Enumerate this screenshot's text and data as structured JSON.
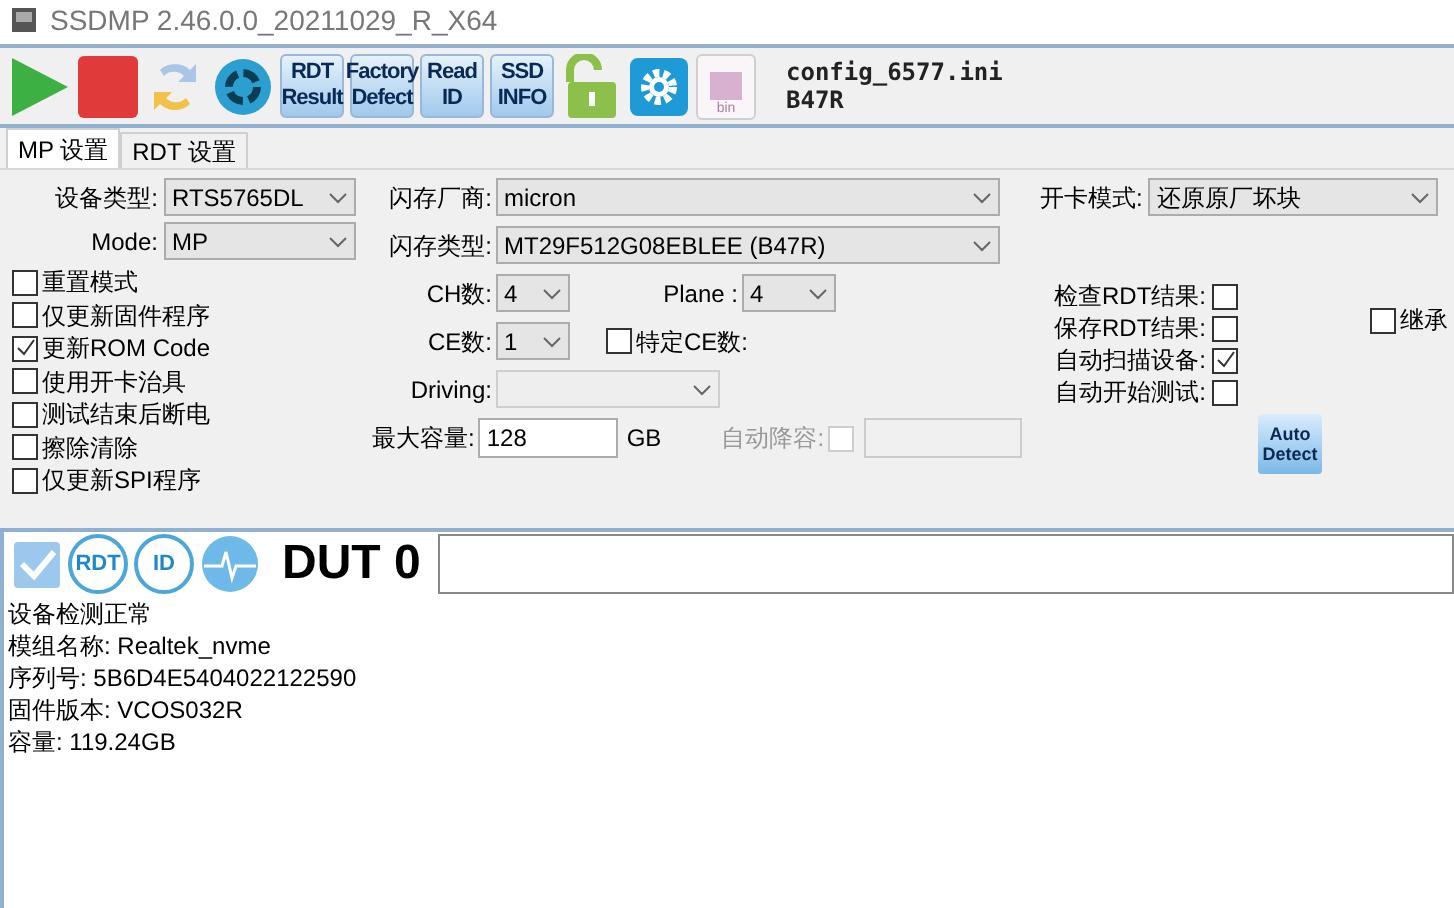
{
  "window": {
    "title": "SSDMP 2.46.0.0_20211029_R_X64"
  },
  "toolbar": {
    "buttons": [
      {
        "kind": "play"
      },
      {
        "kind": "stop"
      },
      {
        "kind": "refresh"
      },
      {
        "kind": "recycle"
      },
      {
        "kind": "text",
        "lines": [
          "RDT",
          "Result"
        ]
      },
      {
        "kind": "text",
        "lines": [
          "Factory",
          "Defect"
        ]
      },
      {
        "kind": "text",
        "lines": [
          "Read",
          "ID"
        ]
      },
      {
        "kind": "text",
        "lines": [
          "SSD",
          "INFO"
        ]
      },
      {
        "kind": "lock"
      },
      {
        "kind": "gear"
      },
      {
        "kind": "bin",
        "lines": [
          "bin"
        ]
      }
    ],
    "config": {
      "file": "config_6577.ini",
      "flash": "B47R"
    }
  },
  "tabs": [
    {
      "label": "MP 设置",
      "selected": true
    },
    {
      "label": "RDT 设置",
      "selected": false
    }
  ],
  "left": {
    "device_type": {
      "label": "设备类型:",
      "value": "RTS5765DL"
    },
    "mode": {
      "label": "Mode:",
      "value": "MP"
    },
    "options": [
      {
        "label": "重置模式",
        "checked": false
      },
      {
        "label": "仅更新固件程序",
        "checked": false
      },
      {
        "label": "更新ROM Code",
        "checked": true
      },
      {
        "label": "使用开卡治具",
        "checked": false
      },
      {
        "label": "测试结束后断电",
        "checked": false
      },
      {
        "label": "擦除清除",
        "checked": false
      },
      {
        "label": "仅更新SPI程序",
        "checked": false
      }
    ]
  },
  "middle": {
    "flash_vendor": {
      "label": "闪存厂商:",
      "value": "micron"
    },
    "flash_type": {
      "label": "闪存类型:",
      "value": "MT29F512G08EBLEE (B47R)"
    },
    "ch": {
      "label": "CH数:",
      "value": "4"
    },
    "plane": {
      "label": "Plane :",
      "value": "4"
    },
    "ce": {
      "label": "CE数:",
      "value": "1"
    },
    "specific_ce": {
      "label": "特定CE数:",
      "checked": false
    },
    "driving": {
      "label": "Driving:",
      "disabled": true
    },
    "max_capacity": {
      "label": "最大容量:",
      "value": "128",
      "unit": "GB"
    },
    "auto_reduce": {
      "label": "自动降容:",
      "checked": false,
      "disabled": true
    }
  },
  "right": {
    "card_mode": {
      "label": "开卡模式:",
      "value": "还原原厂坏块"
    },
    "checks": [
      {
        "label": "检查RDT结果:",
        "checked": false
      },
      {
        "label": "保存RDT结果:",
        "checked": false
      },
      {
        "label": "自动扫描设备:",
        "checked": true
      },
      {
        "label": "自动开始测试:",
        "checked": false
      }
    ],
    "inherit": {
      "label": "继承",
      "checked": false
    },
    "auto_detect": {
      "lines": [
        "Auto",
        "Detect"
      ]
    }
  },
  "dut": {
    "badges": [
      "RDT",
      "ID"
    ],
    "title": "DUT 0",
    "log": [
      "设备检测正常",
      "模组名称: Realtek_nvme",
      "序列号: 5B6D4E5404022122590",
      "固件版本: VCOS032R",
      "容量: 119.24GB"
    ]
  }
}
